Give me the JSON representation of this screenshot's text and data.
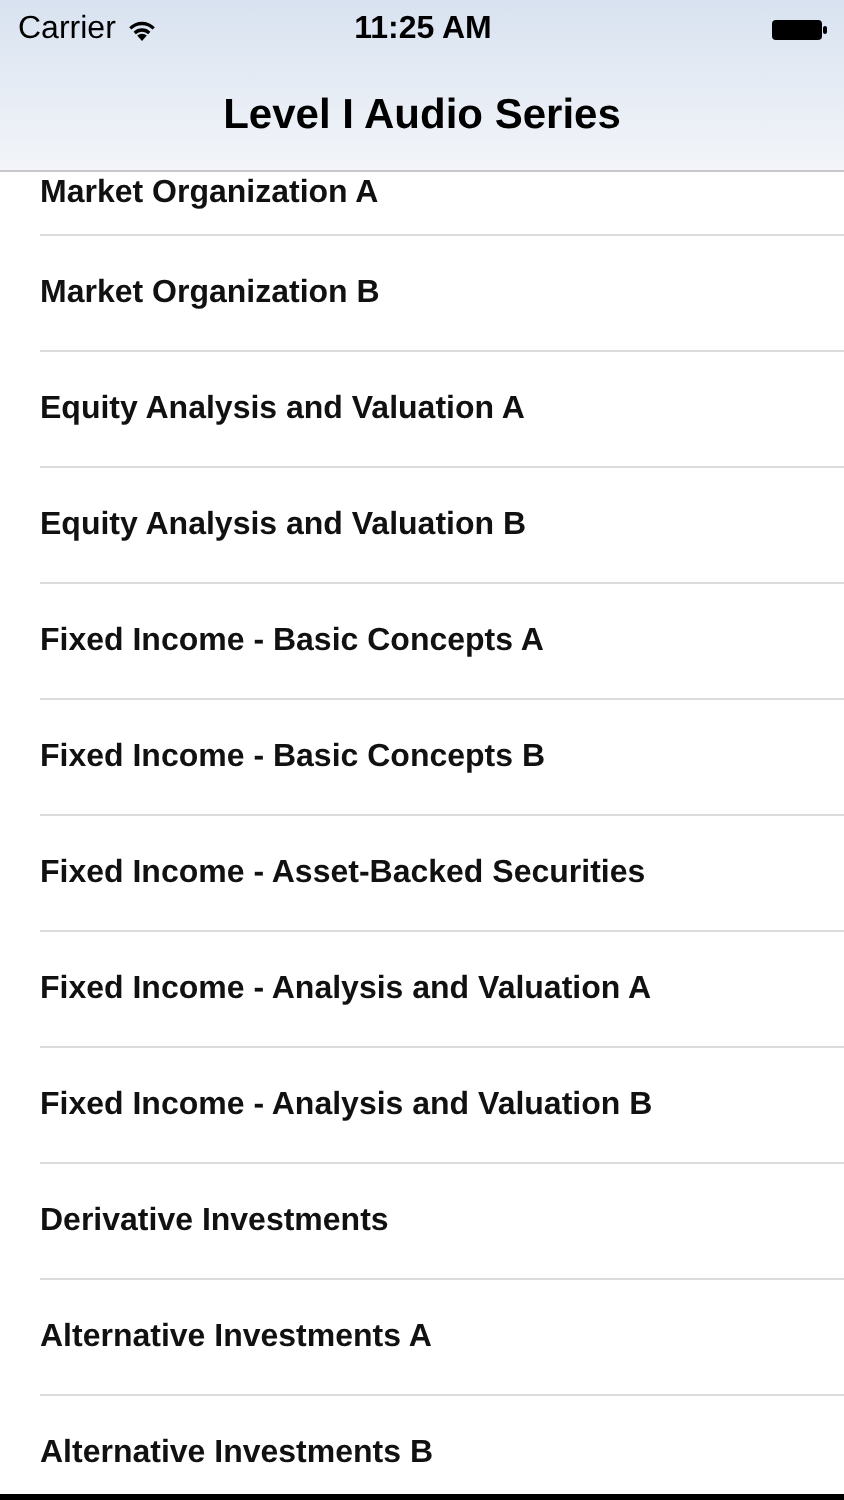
{
  "status_bar": {
    "carrier": "Carrier",
    "time": "11:25 AM"
  },
  "navigation_bar": {
    "title": "Level I Audio Series"
  },
  "list": {
    "items": [
      {
        "title": "Market Organization A"
      },
      {
        "title": "Market Organization B"
      },
      {
        "title": "Equity Analysis and Valuation A"
      },
      {
        "title": "Equity Analysis and Valuation B"
      },
      {
        "title": "Fixed Income - Basic Concepts A"
      },
      {
        "title": "Fixed Income - Basic Concepts B"
      },
      {
        "title": "Fixed Income - Asset-Backed Securities"
      },
      {
        "title": "Fixed Income - Analysis and Valuation A"
      },
      {
        "title": "Fixed Income - Analysis and Valuation B"
      },
      {
        "title": "Derivative Investments"
      },
      {
        "title": "Alternative Investments A"
      },
      {
        "title": "Alternative Investments B"
      }
    ]
  }
}
